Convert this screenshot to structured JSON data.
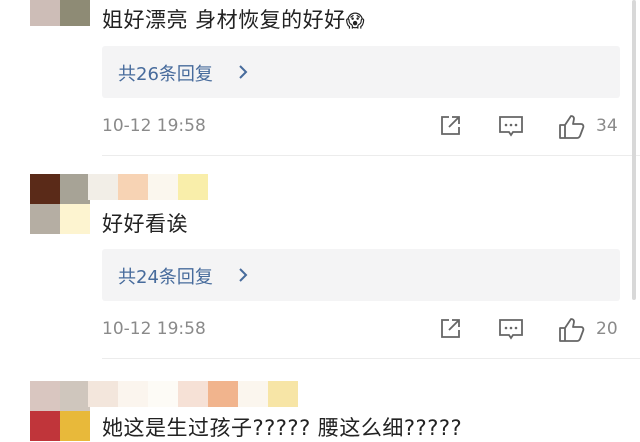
{
  "comments": [
    {
      "text": "姐好漂亮 身材恢复的好好",
      "emoji": "😱",
      "replies_label": "共26条回复",
      "time": "10-12 19:58",
      "likes": "34"
    },
    {
      "text": "好好看诶",
      "replies_label": "共24条回复",
      "time": "10-12 19:58",
      "likes": "20"
    },
    {
      "text": "她这是生过孩子????? 腰这么细?????"
    }
  ],
  "colors": {
    "link": "#476b9c",
    "text": "#222222",
    "meta": "#8a8a8a",
    "reply_bg": "#f4f4f5"
  },
  "icons": [
    "share-icon",
    "comment-icon",
    "like-icon",
    "chevron-right-icon"
  ]
}
